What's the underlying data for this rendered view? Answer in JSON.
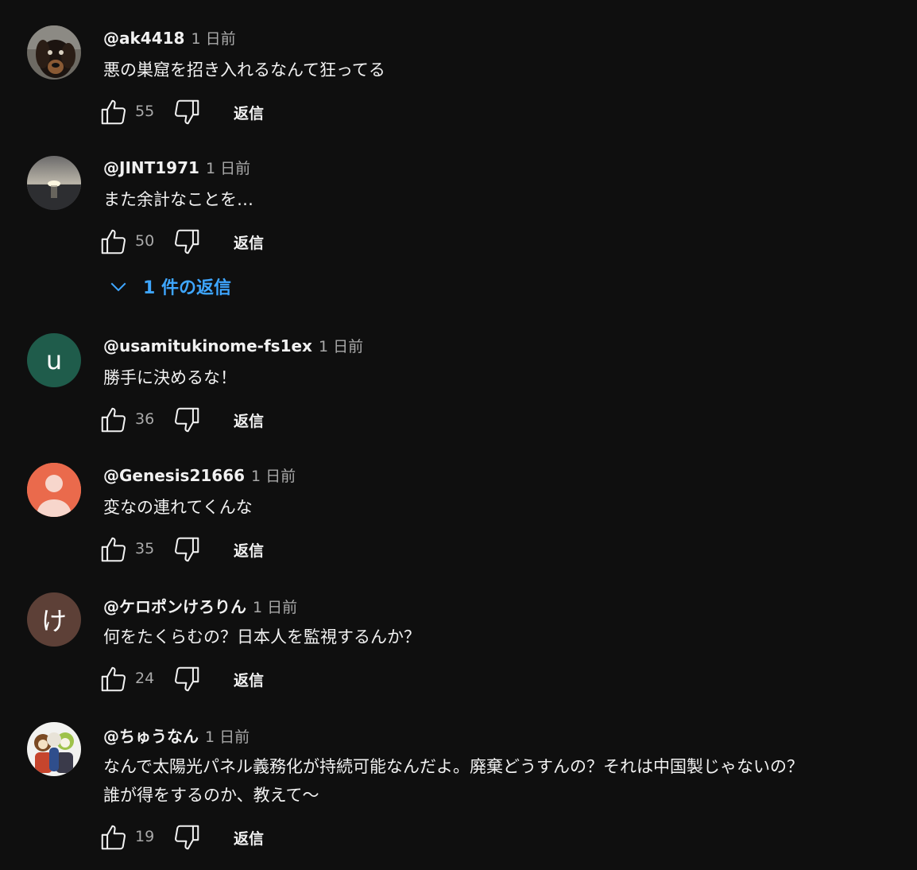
{
  "labels": {
    "reply": "返信"
  },
  "colors": {
    "background": "#0f0f0f",
    "link": "#3ea6ff",
    "secondary_text": "#aaaaaa"
  },
  "comments": [
    {
      "author": "@ak4418",
      "time": "1 日前",
      "lines": [
        "悪の巣窟を招き入れるなんて狂ってる"
      ],
      "likes": "55",
      "avatar": {
        "type": "photo",
        "icon": "dachshund-dog-photo"
      }
    },
    {
      "author": "@JINT1971",
      "time": "1 日前",
      "lines": [
        "また余計なことを…"
      ],
      "likes": "50",
      "avatar": {
        "type": "photo",
        "icon": "sunset-sea-photo"
      },
      "replies_label": "1 件の返信"
    },
    {
      "author": "@usamitukinome-fs1ex",
      "time": "1 日前",
      "lines": [
        "勝手に決めるな！"
      ],
      "likes": "36",
      "avatar": {
        "type": "letter",
        "letter": "u",
        "color": "#1f5c4b"
      }
    },
    {
      "author": "@Genesis21666",
      "time": "1 日前",
      "lines": [
        "変なの連れてくんな"
      ],
      "likes": "35",
      "avatar": {
        "type": "default",
        "icon": "default-person-avatar",
        "color": "#ea6a4c"
      }
    },
    {
      "author": "@ケロポンけろりん",
      "time": "1 日前",
      "lines": [
        "何をたくらむの？日本人を監視するんか？"
      ],
      "likes": "24",
      "avatar": {
        "type": "letter",
        "letter": "け",
        "color": "#5d4037"
      }
    },
    {
      "author": "@ちゅうなん",
      "time": "1 日前",
      "lines": [
        "なんで太陽光パネル義務化が持続可能なんだよ。廃棄どうすんの？それは中国製じゃないの？",
        "誰が得をするのか、教えて〜"
      ],
      "likes": "19",
      "avatar": {
        "type": "photo",
        "icon": "mascot-characters-photo"
      }
    }
  ]
}
